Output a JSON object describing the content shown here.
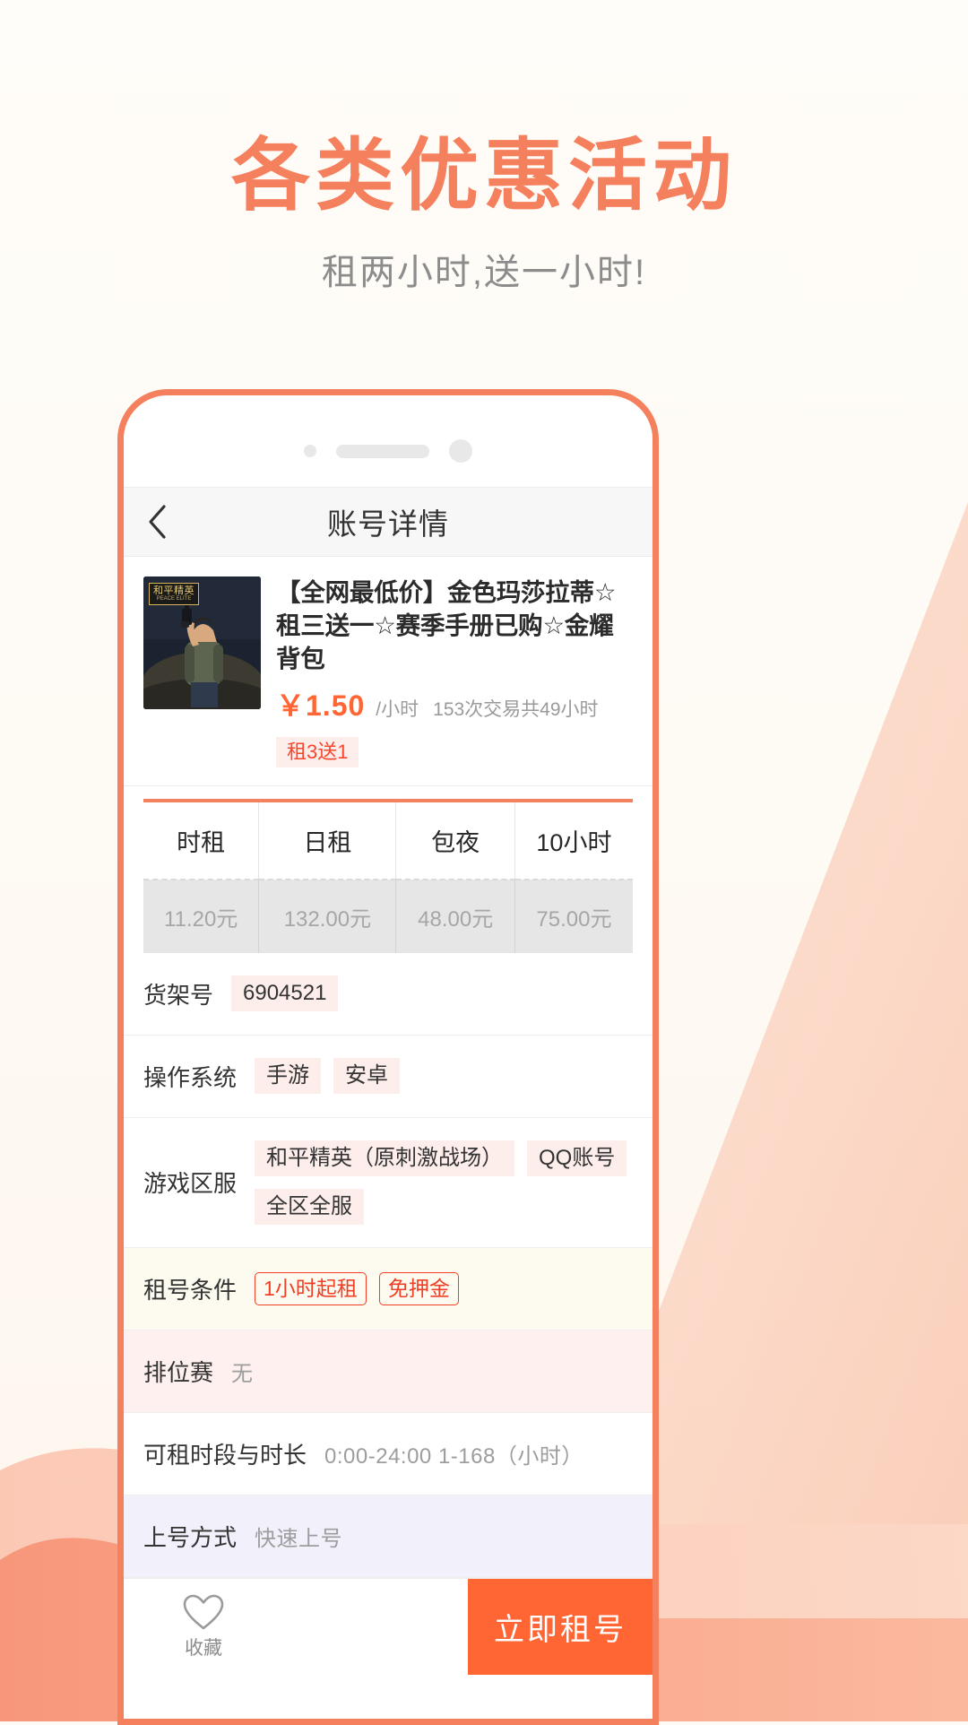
{
  "promo": {
    "title": "各类优惠活动",
    "subtitle": "租两小时,送一小时!",
    "accent_color": "#f5805e"
  },
  "phone": {
    "navbar": {
      "back_icon": "chevron-left-icon",
      "title": "账号详情"
    },
    "product": {
      "thumbnail_badge": "和平精英",
      "thumbnail_badge_sub": "PEACE ELITE",
      "title": "【全网最低价】金色玛莎拉蒂☆租三送一☆赛季手册已购☆金耀背包",
      "price": "￥1.50",
      "price_unit": "/小时",
      "price_stats": "153次交易共49小时",
      "promo_tag": "租3送1",
      "price_color": "#ff6633"
    },
    "rate_table": {
      "headers": [
        "时租",
        "日租",
        "包夜",
        "10小时"
      ],
      "values": [
        "11.20元",
        "132.00元",
        "48.00元",
        "75.00元"
      ],
      "top_border_color": "#f5805e"
    },
    "info_rows": [
      {
        "label": "货架号",
        "chips": [
          "6904521"
        ],
        "plain": "",
        "style": "white"
      },
      {
        "label": "操作系统",
        "chips": [
          "手游",
          "安卓"
        ],
        "plain": "",
        "style": "white"
      },
      {
        "label": "游戏区服",
        "chips": [
          "和平精英（原刺激战场）",
          "QQ账号",
          "全区全服"
        ],
        "plain": "",
        "style": "white"
      },
      {
        "label": "租号条件",
        "chips": [
          "1小时起租",
          "免押金"
        ],
        "plain": "",
        "style": "cream",
        "chip_style": "outline"
      },
      {
        "label": "排位赛",
        "chips": [],
        "plain": "无",
        "style": "pink"
      },
      {
        "label": "可租时段与时长",
        "chips": [],
        "plain": "0:00-24:00  1-168（小时）",
        "style": "white"
      },
      {
        "label": "上号方式",
        "chips": [],
        "plain": "快速上号",
        "style": "lilac"
      }
    ],
    "bottom_bar": {
      "fav_icon": "heart-outline-icon",
      "fav_label": "收藏",
      "buy_label": "立即租号",
      "buy_color": "#ff6633"
    }
  }
}
